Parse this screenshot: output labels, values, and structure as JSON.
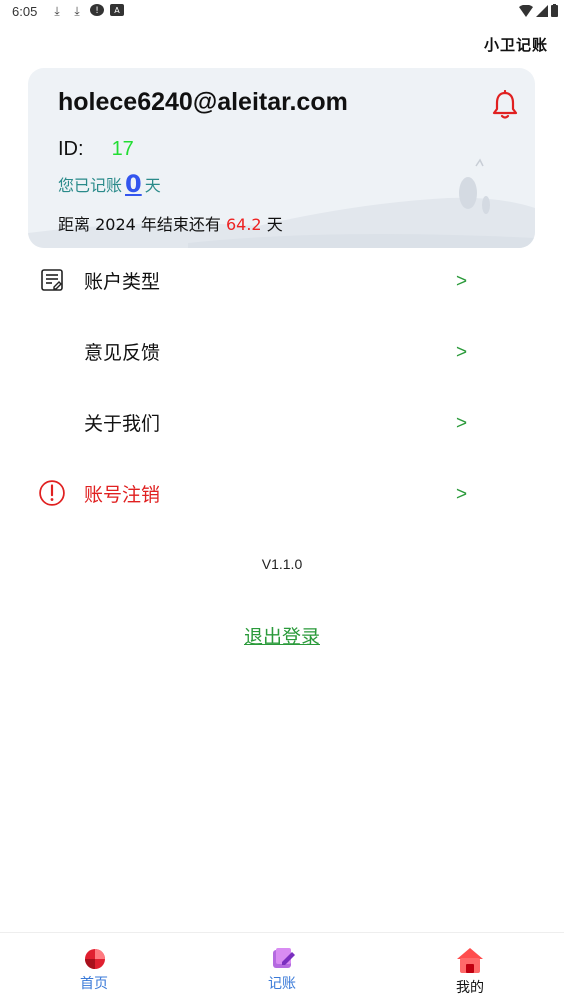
{
  "status_bar": {
    "time": "6:05"
  },
  "app": {
    "logo_text": "小卫记账"
  },
  "profile": {
    "email": "holece6240@aleitar.com",
    "id_label": "ID:",
    "id_value": "17",
    "days_prefix": "您已记账",
    "days_count": "0",
    "days_suffix": "天",
    "year_prefix": "距离 2024 年结束还有 ",
    "year_remaining": "64.2",
    "year_suffix": " 天"
  },
  "menu": {
    "items": [
      {
        "label": "账户类型",
        "arrow": ">",
        "icon": "note-edit-icon"
      },
      {
        "label": "意见反馈",
        "arrow": ">",
        "icon": ""
      },
      {
        "label": "关于我们",
        "arrow": ">",
        "icon": ""
      },
      {
        "label": "账号注销",
        "arrow": ">",
        "icon": "alert-circle-icon"
      }
    ]
  },
  "version": "V1.1.0",
  "logout_label": "退出登录",
  "bottom_nav": [
    {
      "label": "首页",
      "icon": "pie-chart-icon",
      "color": "#3a7ad8"
    },
    {
      "label": "记账",
      "icon": "notebook-icon",
      "color": "#3a7ad8"
    },
    {
      "label": "我的",
      "icon": "home-icon",
      "color": "#111111"
    }
  ],
  "colors": {
    "accent_green": "#2a9a3a",
    "danger_red": "#e02020",
    "id_green": "#22dd33",
    "link_blue": "#3355ee"
  }
}
